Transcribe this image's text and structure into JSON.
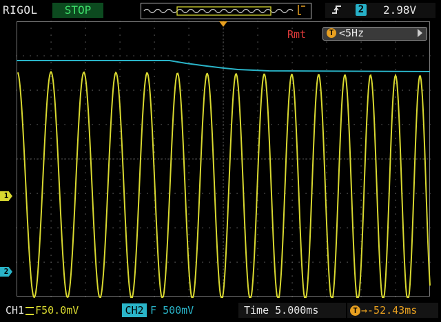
{
  "header": {
    "brand": "RIGOL",
    "run_state": "STOP",
    "trigger": {
      "edge_icon": "rising-edge-icon",
      "source": "2",
      "level": "2.98V"
    }
  },
  "measurement": {
    "mode": "Rmt",
    "badge": "T",
    "value": "<5Hz"
  },
  "channel_markers": {
    "ch1": "1",
    "ch2": "2"
  },
  "footer": {
    "ch1": "CH1",
    "ch1_scale": "F50.0mV",
    "ch2": "CH2",
    "ch2_coupling": "F",
    "ch2_scale": "500mV",
    "timebase_label": "Time",
    "timebase_value": "5.000ms",
    "trigger_badge": "T",
    "trigger_offset": "→-52.43ms"
  },
  "colors": {
    "ch1": "#d8d830",
    "ch2": "#2ab4c8",
    "trigger": "#e8a020",
    "status_bg": "#0c4a1f",
    "status_fg": "#3ee06b"
  }
}
